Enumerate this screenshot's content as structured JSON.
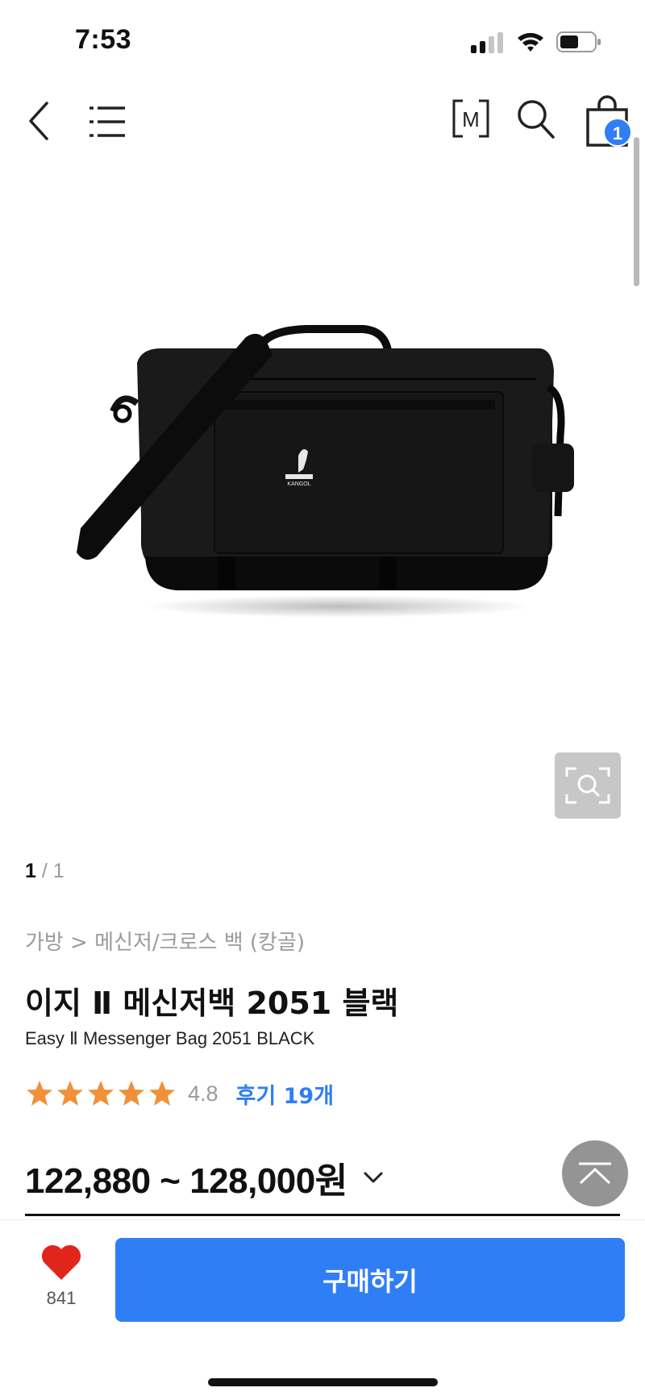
{
  "status_bar": {
    "time": "7:53"
  },
  "nav": {
    "m_label": "M",
    "cart_count": "1"
  },
  "gallery": {
    "current_page": "1",
    "separator": " / ",
    "total_pages": "1",
    "logo_text": "KANGOL"
  },
  "product": {
    "breadcrumb": "가방 > 메신저/크로스 백 (캉골)",
    "title": "이지 Ⅱ 메신저백 2051 블랙",
    "subtitle": "Easy Ⅱ Messenger Bag 2051 BLACK",
    "rating": 4.8,
    "rating_text": "4.8",
    "star_count": 5,
    "review_link": "후기 19개",
    "price_range": "122,880 ~ 128,000",
    "currency": "원"
  },
  "bottom_bar": {
    "like_count": "841",
    "buy_label": "구매하기"
  },
  "colors": {
    "accent": "#2f7ef6",
    "star": "#f0913a",
    "heart": "#e0261a"
  },
  "icons": [
    "back-arrow-icon",
    "menu-list-icon",
    "m-membership-icon",
    "search-icon",
    "cart-bag-icon",
    "zoom-search-icon",
    "star-icon",
    "chevron-down-icon",
    "scroll-top-icon",
    "heart-icon"
  ]
}
